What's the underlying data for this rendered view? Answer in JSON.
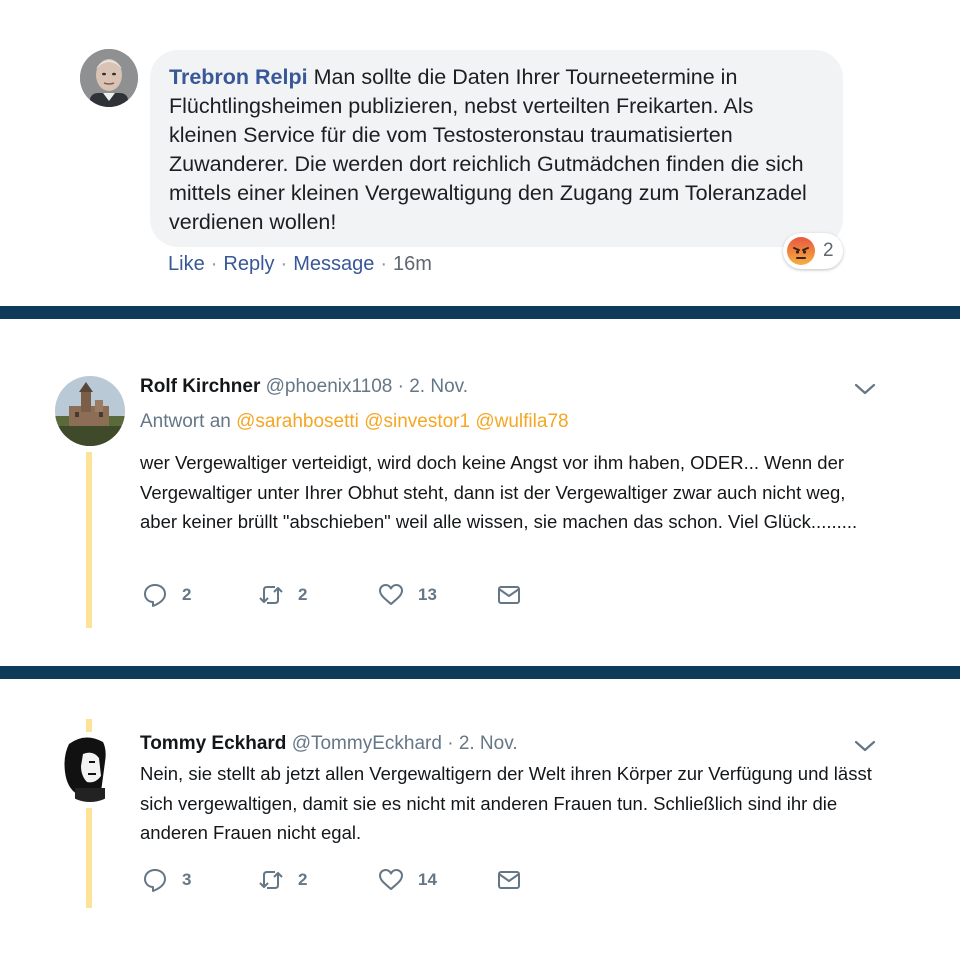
{
  "facebook_comment": {
    "author": "Trebron Relpi",
    "text": "Man sollte die Daten Ihrer Tourneetermine in Flüchtlingsheimen publizieren, nebst verteilten Freikarten. Als kleinen Service für die vom Testosteronstau traumatisierten Zuwanderer. Die werden dort reichlich Gutmädchen finden die sich mittels einer kleinen Vergewaltigung den Zugang zum Toleranzadel verdienen wollen!",
    "actions": {
      "like": "Like",
      "reply": "Reply",
      "message": "Message",
      "separator": "·",
      "time": "16m"
    },
    "reaction": {
      "icon": "angry-reaction-icon",
      "count": "2"
    }
  },
  "tweets": [
    {
      "author_name": "Rolf Kirchner",
      "handle": "@phoenix1108",
      "separator": "·",
      "date": "2. Nov.",
      "reply_to_label": "Antwort an",
      "reply_to": [
        "@sarahbosetti",
        "@sinvestor1",
        "@wulfila78"
      ],
      "text": "wer Vergewaltiger verteidigt, wird doch keine Angst vor ihm haben, ODER... Wenn der Vergewaltiger unter Ihrer Obhut steht, dann ist der Vergewaltiger zwar auch nicht weg, aber keiner brüllt \"abschieben\" weil alle wissen, sie machen das schon. Viel Glück.........",
      "replies": "2",
      "retweets": "2",
      "likes": "13"
    },
    {
      "author_name": "Tommy Eckhard",
      "handle": "@TommyEckhard",
      "separator": "·",
      "date": "2. Nov.",
      "text": "Nein, sie stellt ab jetzt allen Vergewaltigern der Welt ihren Körper zur Verfügung und lässt sich vergewaltigen, damit sie es nicht mit anderen Frauen tun. Schließlich sind ihr die anderen Frauen nicht egal.",
      "replies": "3",
      "retweets": "2",
      "likes": "14"
    }
  ],
  "colors": {
    "facebook_link": "#385898",
    "twitter_mention": "#f5a623",
    "thread_line": "#fde398",
    "divider": "#0f3b5a"
  }
}
